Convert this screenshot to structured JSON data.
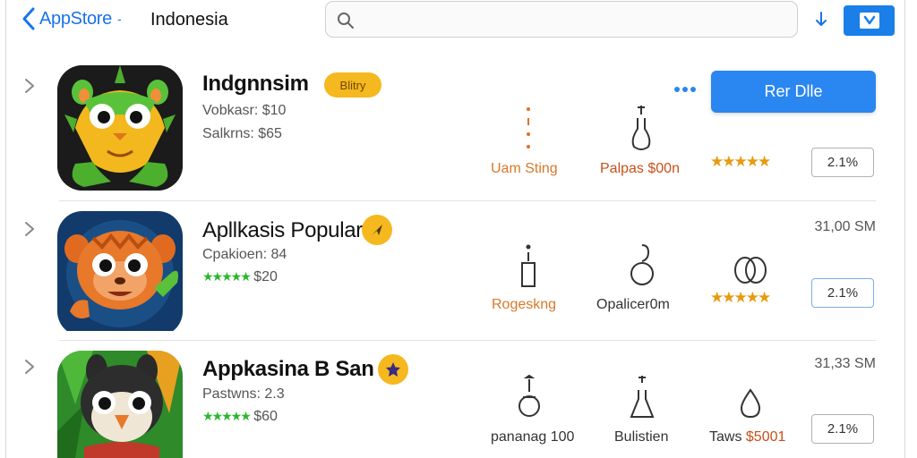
{
  "header": {
    "back_label": "AppStore",
    "region": "Indonesia",
    "search_placeholder": ""
  },
  "apps": [
    {
      "name": "Indgnnsim",
      "badge": "Blitry",
      "line1": "Vobkasr: $10",
      "line2": "Salkrns: $65",
      "feature1": "Uam Sting",
      "feature2": "Palpas $00n",
      "stars": "★★★★★",
      "size": "2.1%",
      "action": "Rer Dlle"
    },
    {
      "name": "Apllkasis Popular",
      "price_right": "31,00 SM",
      "line1": "Cpakioen: 84",
      "line2": "$20",
      "feature1": "Rogeskng",
      "feature2": "Opalicer0m",
      "stars": "★★★★★",
      "size": "2.1%"
    },
    {
      "name": "Appkasina B San",
      "price_right": "31,33 SM",
      "line1": "Pastwns: 2.3",
      "line2": "$60",
      "feature1": "pananag 100",
      "feature2": "Bulistien",
      "feature3_label": "Taws",
      "feature3_price": "$5001",
      "size": "2.1%"
    }
  ],
  "colors": {
    "accent_blue": "#1a7fe8",
    "badge_yellow": "#f6b81f",
    "star_orange": "#e89a10",
    "star_green": "#2db52d"
  }
}
